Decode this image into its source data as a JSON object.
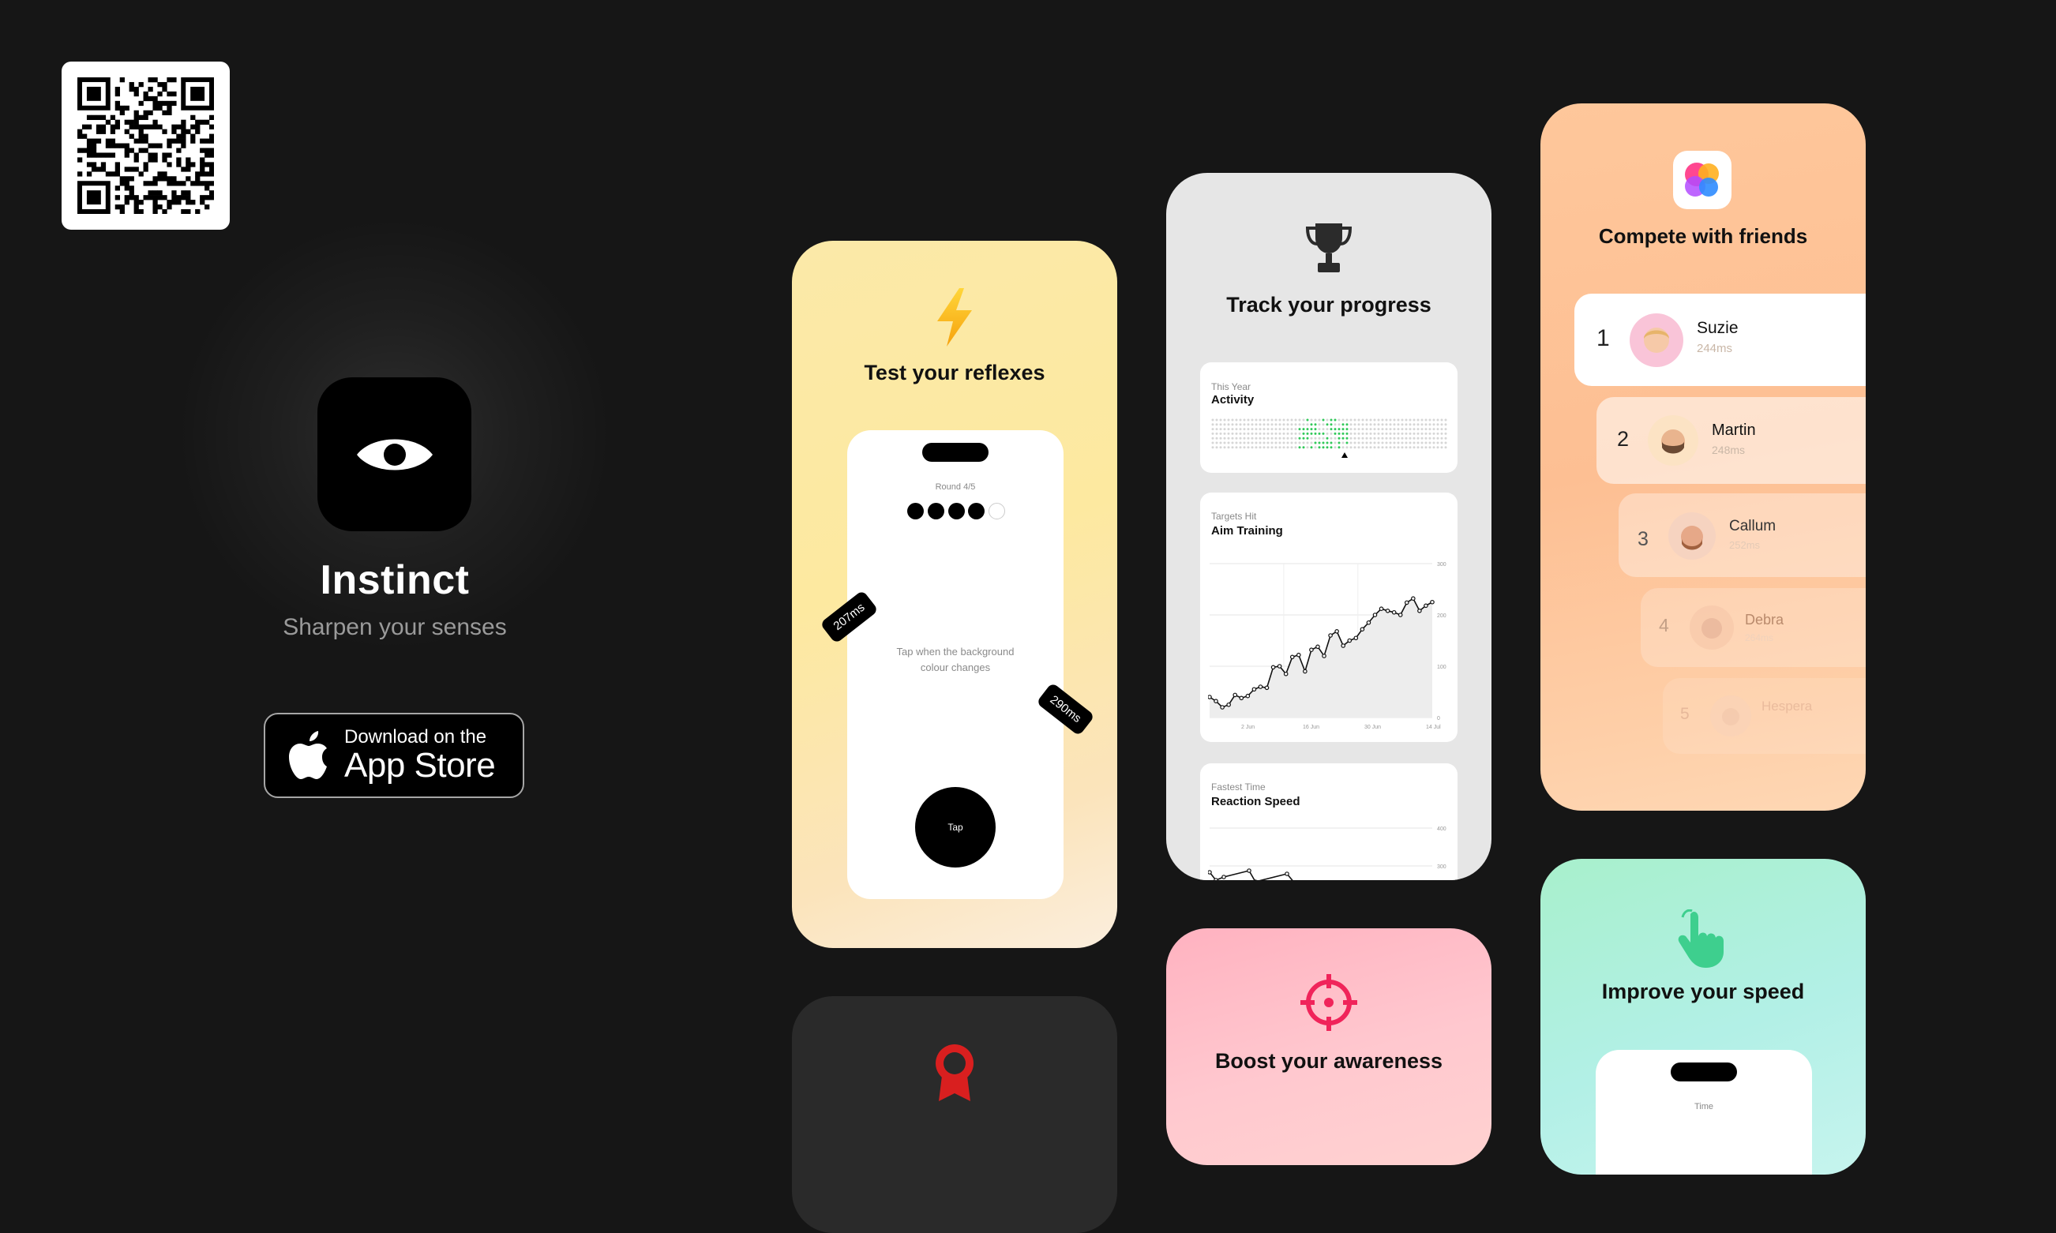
{
  "app": {
    "name": "Instinct",
    "tagline": "Sharpen your senses"
  },
  "store_button": {
    "small": "Download on the",
    "big": "App Store"
  },
  "icons": {
    "qr": "qr-code",
    "app": "eye-icon",
    "apple": "apple-logo-icon",
    "lightning": "lightning-icon",
    "trophy": "trophy-icon",
    "game_center": "game-center-icon",
    "ribbon": "ribbon-icon",
    "target": "crosshair-icon",
    "tap": "pointing-hand-icon"
  },
  "card_reflexes": {
    "title": "Test your reflexes",
    "round": "Round 4/5",
    "rounds_done": 4,
    "rounds_total": 5,
    "instruction_line1": "Tap when the background",
    "instruction_line2": "colour changes",
    "tag_left": "207ms",
    "tag_right": "290ms",
    "button": "Tap"
  },
  "card_progress": {
    "title": "Track your progress",
    "activity": {
      "sub": "This Year",
      "title": "Activity"
    },
    "aim": {
      "sub": "Targets Hit",
      "title": "Aim Training",
      "y_ticks": [
        "300",
        "200",
        "100",
        "0"
      ],
      "x_ticks": [
        "2 Jun",
        "16 Jun",
        "30 Jun",
        "14 Jul"
      ]
    },
    "reaction": {
      "sub": "Fastest Time",
      "title": "Reaction Speed",
      "y_ticks": [
        "400",
        "300"
      ]
    }
  },
  "card_friends": {
    "title": "Compete with friends",
    "rows": [
      {
        "rank": "1",
        "name": "Suzie",
        "time": "244ms"
      },
      {
        "rank": "2",
        "name": "Martin",
        "time": "248ms"
      },
      {
        "rank": "3",
        "name": "Callum",
        "time": "252ms"
      },
      {
        "rank": "4",
        "name": "Debra",
        "time": "264ms"
      },
      {
        "rank": "5",
        "name": "Hespera",
        "time": ""
      }
    ]
  },
  "card_awareness": {
    "title": "Boost your awareness"
  },
  "card_speed": {
    "title": "Improve your speed",
    "phone_label": "Time"
  },
  "colors": {
    "background": "#161616",
    "activity_green": "#32c85a",
    "awareness_pink": "#f0245a",
    "ribbon_red": "#d91f1f",
    "speed_green": "#3ecf8e"
  }
}
